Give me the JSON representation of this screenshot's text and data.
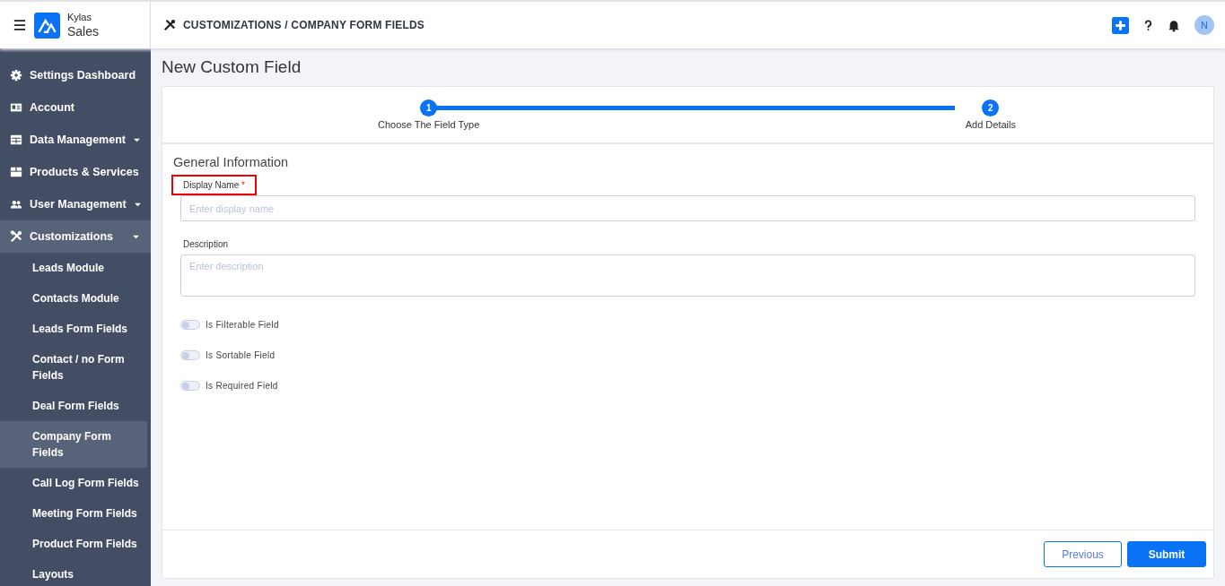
{
  "header": {
    "brand_top": "Kylas",
    "brand_bottom": "Sales",
    "breadcrumb": "CUSTOMIZATIONS / COMPANY FORM FIELDS",
    "avatar": "N"
  },
  "sidebar": {
    "items": [
      {
        "label": "Settings Dashboard",
        "selected": false
      },
      {
        "label": "Account",
        "selected": false
      },
      {
        "label": "Data Management",
        "expandable": true,
        "selected": false
      },
      {
        "label": "Products & Services",
        "selected": false
      },
      {
        "label": "User Management",
        "expandable": true,
        "selected": false
      },
      {
        "label": "Customizations",
        "expandable": true,
        "expanded": true,
        "selected": true,
        "children": [
          {
            "label": "Leads Module",
            "selected": false
          },
          {
            "label": "Contacts Module",
            "selected": false
          },
          {
            "label": "Leads Form Fields",
            "selected": false
          },
          {
            "label": "Contact / no Form Fields",
            "selected": false
          },
          {
            "label": "Deal Form Fields",
            "selected": false
          },
          {
            "label": "Company Form Fields",
            "selected": true
          },
          {
            "label": "Call Log Form Fields",
            "selected": false
          },
          {
            "label": "Meeting Form Fields",
            "selected": false
          },
          {
            "label": "Product Form Fields",
            "selected": false
          },
          {
            "label": "Layouts",
            "selected": false
          }
        ]
      }
    ]
  },
  "page_title": "New Custom Field",
  "steps": [
    {
      "number": "1",
      "label": "Choose The Field Type",
      "done": true
    },
    {
      "number": "2",
      "label": "Add Details",
      "done": true
    }
  ],
  "section_title": "General Information",
  "fields": [
    {
      "label": "Display Name",
      "required": true,
      "highlighted": true,
      "placeholder": "Enter display name",
      "kind": "input"
    },
    {
      "label": "Description",
      "required": false,
      "highlighted": false,
      "placeholder": "Enter description",
      "kind": "textarea"
    }
  ],
  "required_mark": "*",
  "toggles": [
    {
      "label": "Is Filterable Field",
      "on": false
    },
    {
      "label": "Is Sortable Field",
      "on": false
    },
    {
      "label": "Is Required Field",
      "on": false
    }
  ],
  "buttons": [
    {
      "label": "Previous",
      "kind": "outline"
    },
    {
      "label": "Submit",
      "kind": "primary"
    }
  ]
}
